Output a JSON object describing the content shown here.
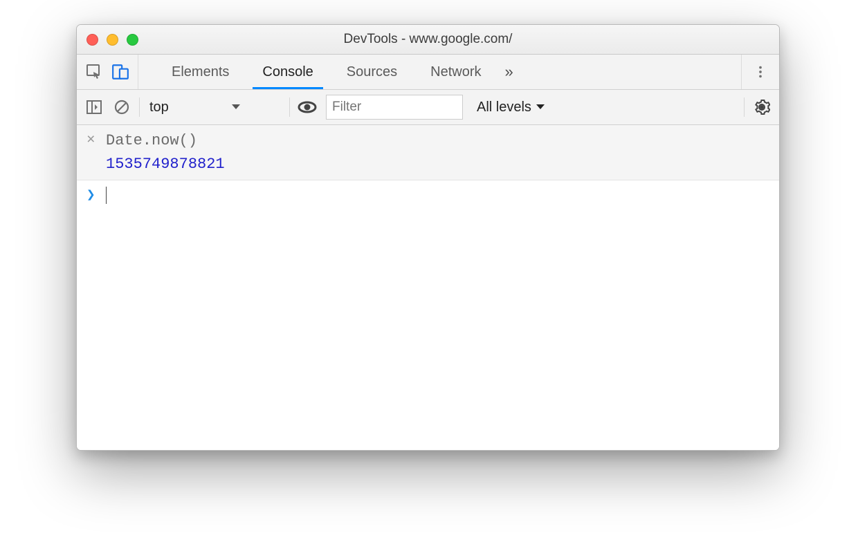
{
  "window": {
    "title": "DevTools - www.google.com/"
  },
  "tabs": {
    "items": [
      {
        "label": "Elements",
        "active": false
      },
      {
        "label": "Console",
        "active": true
      },
      {
        "label": "Sources",
        "active": false
      },
      {
        "label": "Network",
        "active": false
      }
    ],
    "overflow_glyph": "»"
  },
  "console_toolbar": {
    "context_label": "top",
    "filter_placeholder": "Filter",
    "levels_label": "All levels"
  },
  "console": {
    "history": [
      {
        "expression": "Date.now()",
        "result": "1535749878821"
      }
    ],
    "prompt_glyph": "❯",
    "close_glyph": "×"
  }
}
